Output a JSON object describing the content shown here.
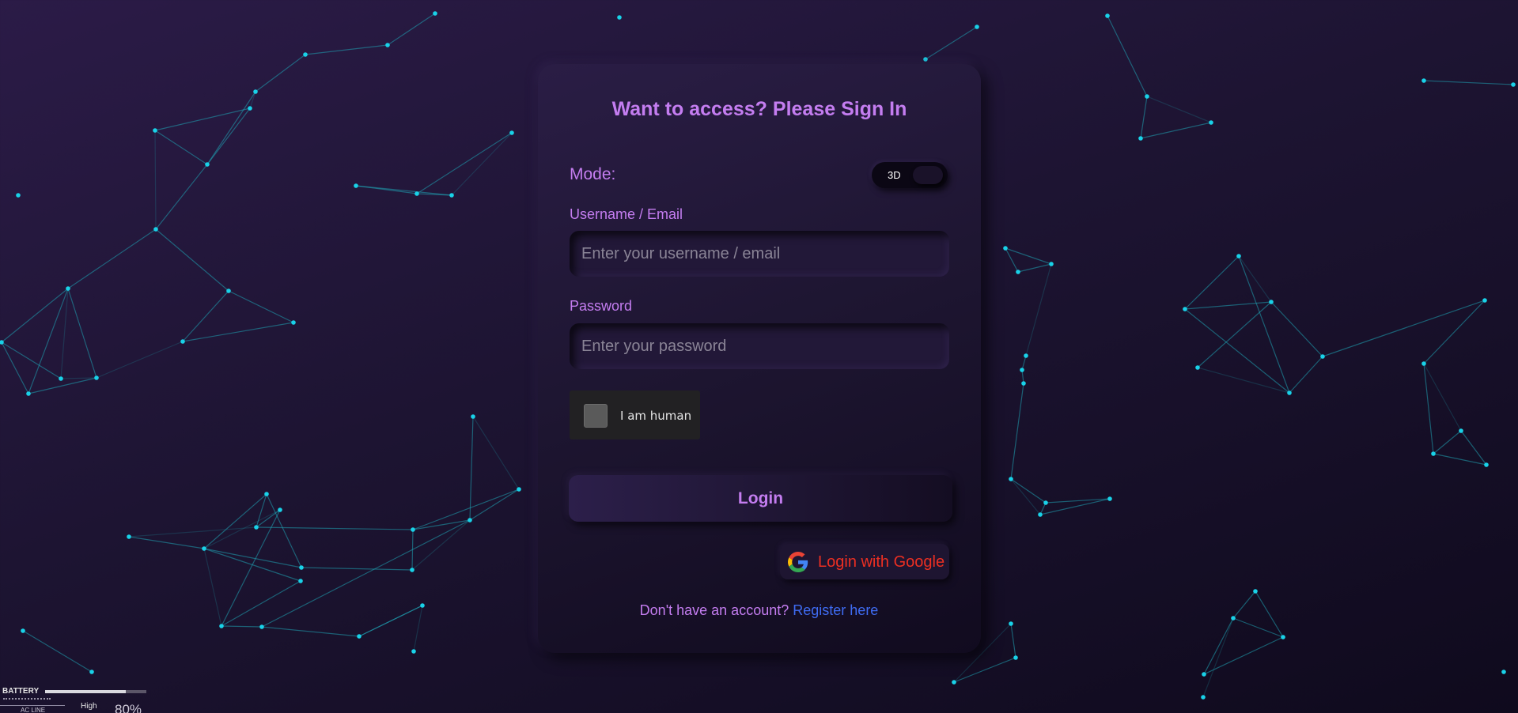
{
  "colors": {
    "accent": "#c47df0",
    "link": "#3f6cf3",
    "google_text": "#ec2f22",
    "network_node": "#19d2e8",
    "background": "#1d1432"
  },
  "card": {
    "title": "Want to access? Please Sign In",
    "mode": {
      "label": "Mode:",
      "value": "3D"
    },
    "username": {
      "label": "Username / Email",
      "placeholder": "Enter your username / email",
      "value": ""
    },
    "password": {
      "label": "Password",
      "placeholder": "Enter your password",
      "value": ""
    },
    "captcha": {
      "label": "I am human",
      "checked": false
    },
    "login_label": "Login",
    "google": {
      "label": "Login with Google",
      "icon": "google-g-icon"
    },
    "register": {
      "prompt": "Don't have an account?",
      "link": "Register here"
    }
  },
  "background": {
    "style": "particle network"
  },
  "battery_widget": {
    "label": "BATTERY",
    "sub_label": "AC LINE",
    "level": "High",
    "percent": "80%",
    "charge_fraction": 0.8
  }
}
